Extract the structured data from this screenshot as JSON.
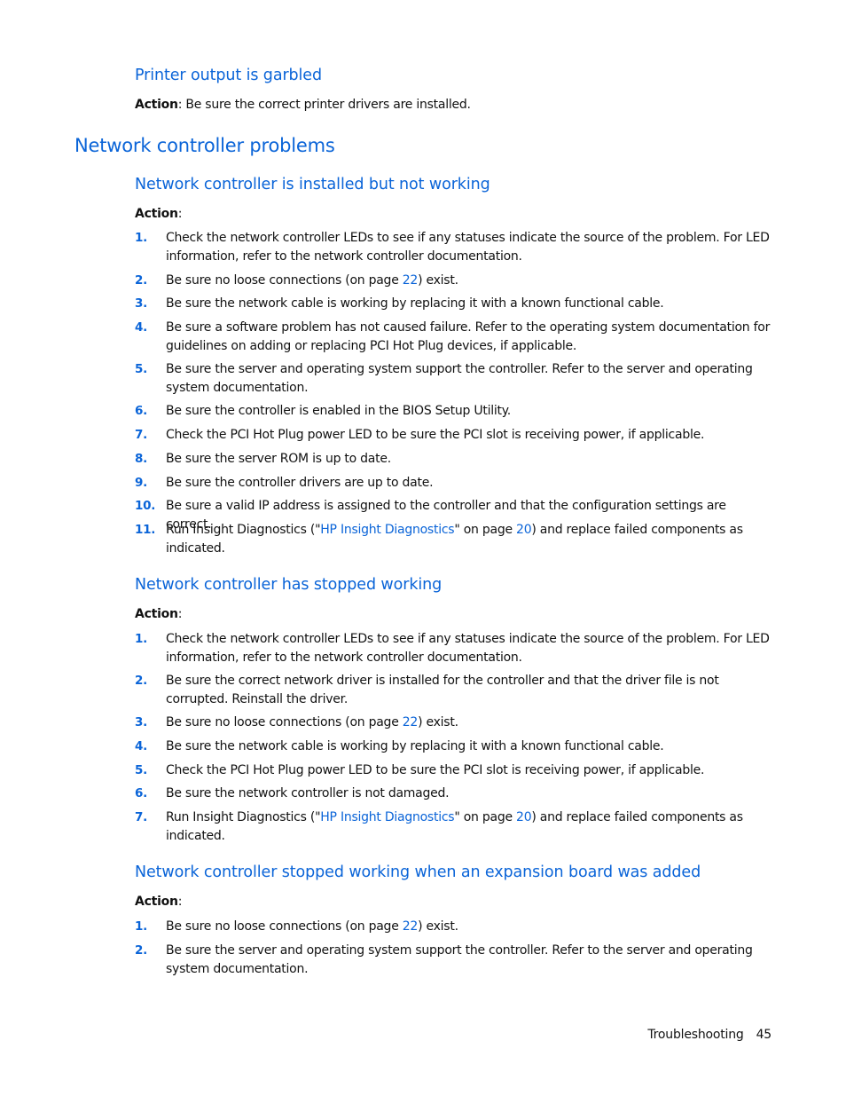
{
  "printer": {
    "heading": "Printer output is garbled",
    "action_label": "Action",
    "action_text": ": Be sure the correct printer drivers are installed."
  },
  "section": {
    "heading": "Network controller problems"
  },
  "sub1": {
    "heading": "Network controller is installed but not working",
    "action_label": "Action",
    "colon": ":",
    "items": [
      {
        "num": "1.",
        "text": "Check the network controller LEDs to see if any statuses indicate the source of the problem. For LED information, refer to the network controller documentation."
      },
      {
        "num": "2.",
        "pre": "Be sure no loose connections (on page ",
        "link": "22",
        "post": ") exist."
      },
      {
        "num": "3.",
        "text": "Be sure the network cable is working by replacing it with a known functional cable."
      },
      {
        "num": "4.",
        "text": "Be sure a software problem has not caused failure. Refer to the operating system documentation for guidelines on adding or replacing PCI Hot Plug devices, if applicable."
      },
      {
        "num": "5.",
        "text": "Be sure the server and operating system support the controller. Refer to the server and operating system documentation."
      },
      {
        "num": "6.",
        "text": "Be sure the controller is enabled in the BIOS Setup Utility."
      },
      {
        "num": "7.",
        "text": "Check the PCI Hot Plug power LED to be sure the PCI slot is receiving power, if applicable."
      },
      {
        "num": "8.",
        "text": "Be sure the server ROM is up to date."
      },
      {
        "num": "9.",
        "text": "Be sure the controller drivers are up to date."
      },
      {
        "num": "10.",
        "text": "Be sure a valid IP address is assigned to the controller and that the configuration settings are correct."
      },
      {
        "num": "11.",
        "pre": "Run Insight Diagnostics (\"",
        "link": "HP Insight Diagnostics",
        "mid": "\" on page ",
        "link2": "20",
        "post": ") and replace failed components as indicated."
      }
    ]
  },
  "sub2": {
    "heading": "Network controller has stopped working",
    "action_label": "Action",
    "colon": ":",
    "items": [
      {
        "num": "1.",
        "text": "Check the network controller LEDs to see if any statuses indicate the source of the problem. For LED information, refer to the network controller documentation."
      },
      {
        "num": "2.",
        "text": "Be sure the correct network driver is installed for the controller and that the driver file is not corrupted. Reinstall the driver."
      },
      {
        "num": "3.",
        "pre": "Be sure no loose connections (on page ",
        "link": "22",
        "post": ") exist."
      },
      {
        "num": "4.",
        "text": "Be sure the network cable is working by replacing it with a known functional cable."
      },
      {
        "num": "5.",
        "text": "Check the PCI Hot Plug power LED to be sure the PCI slot is receiving power, if applicable."
      },
      {
        "num": "6.",
        "text": "Be sure the network controller is not damaged."
      },
      {
        "num": "7.",
        "pre": "Run Insight Diagnostics (\"",
        "link": "HP Insight Diagnostics",
        "mid": "\" on page ",
        "link2": "20",
        "post": ") and replace failed components as indicated."
      }
    ]
  },
  "sub3": {
    "heading": "Network controller stopped working when an expansion board was added",
    "action_label": "Action",
    "colon": ":",
    "items": [
      {
        "num": "1.",
        "pre": "Be sure no loose connections (on page ",
        "link": "22",
        "post": ") exist."
      },
      {
        "num": "2.",
        "text": "Be sure the server and operating system support the controller. Refer to the server and operating system documentation."
      }
    ]
  },
  "footer": {
    "section": "Troubleshooting",
    "page": "45"
  }
}
